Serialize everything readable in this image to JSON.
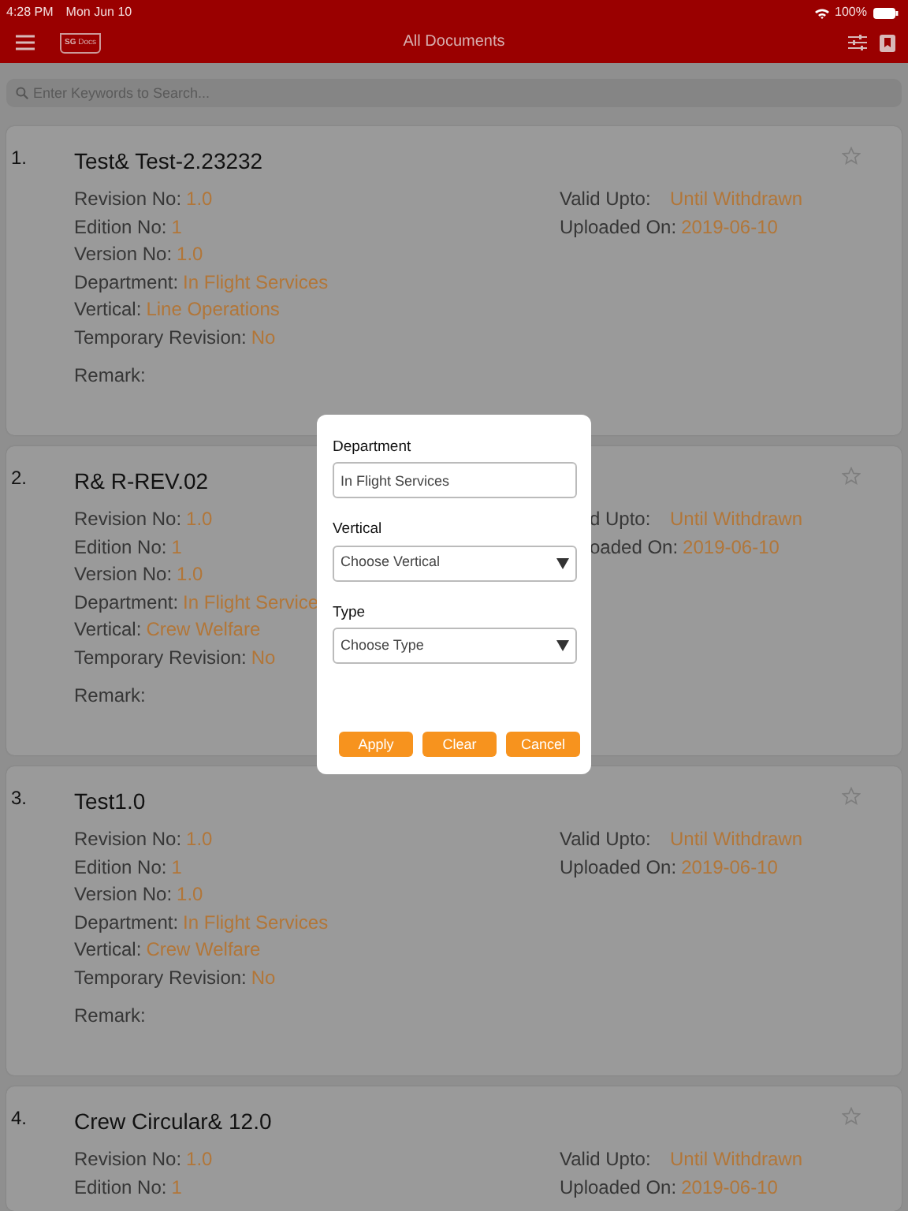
{
  "status_bar": {
    "time": "4:28 PM",
    "date": "Mon Jun 10",
    "battery": "100%"
  },
  "header": {
    "logo": "**SG** Docs",
    "title": "All Documents"
  },
  "search": {
    "placeholder": "Enter Keywords to Search..."
  },
  "documents": [
    {
      "number": "1.",
      "title": "Test& Test-2.23232",
      "starred": false,
      "left": [
        {
          "label": "Revision No:",
          "value": "1.0"
        },
        {
          "label": "Edition No:",
          "value": "1"
        },
        {
          "label": "Version No:",
          "value": "1.0"
        },
        {
          "label": "Department:",
          "value": "In Flight Services"
        },
        {
          "label": "Vertical:",
          "value": "Line Operations"
        },
        {
          "label": "Temporary Revision:",
          "value": "No"
        }
      ],
      "right": [
        {
          "label": "Valid Upto:",
          "value": "Until Withdrawn"
        },
        {
          "label": "Uploaded On:",
          "value": "2019-06-10"
        }
      ],
      "remark": "Remark:"
    },
    {
      "number": "2.",
      "title": "R& R-REV.02",
      "starred": false,
      "left": [
        {
          "label": "Revision No:",
          "value": "1.0"
        },
        {
          "label": "Edition No:",
          "value": "1"
        },
        {
          "label": "Version No:",
          "value": "1.0"
        },
        {
          "label": "Department:",
          "value": "In Flight Service"
        },
        {
          "label": "Vertical:",
          "value": "Crew Welfare"
        },
        {
          "label": "Temporary Revision:",
          "value": "No"
        }
      ],
      "right": [
        {
          "label": "d Upto:",
          "value": "Until Withdrawn"
        },
        {
          "label": "oaded On:",
          "value": "2019-06-10"
        }
      ],
      "remark": "Remark:"
    },
    {
      "number": "3.",
      "title": "Test1.0",
      "starred": false,
      "left": [
        {
          "label": "Revision No:",
          "value": "1.0"
        },
        {
          "label": "Edition No:",
          "value": "1"
        },
        {
          "label": "Version No:",
          "value": "1.0"
        },
        {
          "label": "Department:",
          "value": "In Flight Services"
        },
        {
          "label": "Vertical:",
          "value": "Crew Welfare"
        },
        {
          "label": "Temporary Revision:",
          "value": "No"
        }
      ],
      "right": [
        {
          "label": "Valid Upto:",
          "value": "Until Withdrawn"
        },
        {
          "label": "Uploaded On:",
          "value": "2019-06-10"
        }
      ],
      "remark": "Remark:"
    },
    {
      "number": "4.",
      "title": "Crew Circular& 12.0",
      "starred": false,
      "left": [
        {
          "label": "Revision No:",
          "value": "1.0"
        },
        {
          "label": "Edition No:",
          "value": "1"
        }
      ],
      "right": [
        {
          "label": "Valid Upto:",
          "value": "Until Withdrawn"
        },
        {
          "label": "Uploaded On:",
          "value": "2019-06-10"
        }
      ]
    }
  ],
  "filter_dialog": {
    "fields": [
      {
        "kind": "text",
        "label": "Department",
        "value": "In Flight Services"
      },
      {
        "kind": "select",
        "label": "Vertical",
        "placeholder": "Choose Vertical"
      },
      {
        "kind": "select",
        "label": "Type",
        "placeholder": "Choose Type"
      }
    ],
    "buttons": [
      "Apply",
      "Clear",
      "Cancel"
    ]
  }
}
